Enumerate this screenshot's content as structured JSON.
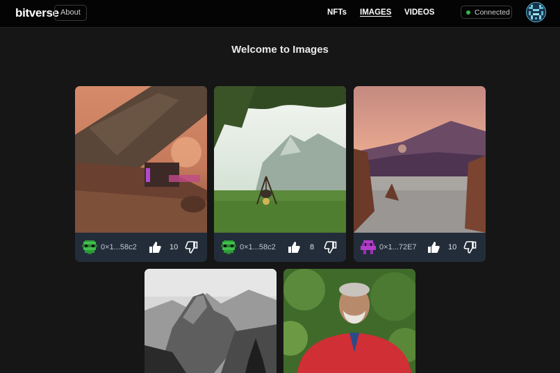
{
  "header": {
    "logo": "bitverse",
    "about_label": "About",
    "nav": [
      {
        "label": "NFTs"
      },
      {
        "label": "IMAGES"
      },
      {
        "label": "VIDEOS"
      }
    ],
    "connection_status": "Connected",
    "colors": {
      "status_dot": "#2fb84a"
    }
  },
  "main": {
    "title": "Welcome to Images",
    "cards": [
      {
        "author": "0×1...58c2",
        "likes": "10",
        "image": "sci-fi desert wreck scene"
      },
      {
        "author": "0×1...58c2",
        "likes": "8",
        "image": "campfire tripod in grassy valley"
      },
      {
        "author": "0×1...72E7",
        "likes": "10",
        "image": "mountain lake at sunset"
      },
      {
        "image": "black and white granite mountain"
      },
      {
        "image": "portrait of bearded man in red jacket"
      }
    ]
  }
}
